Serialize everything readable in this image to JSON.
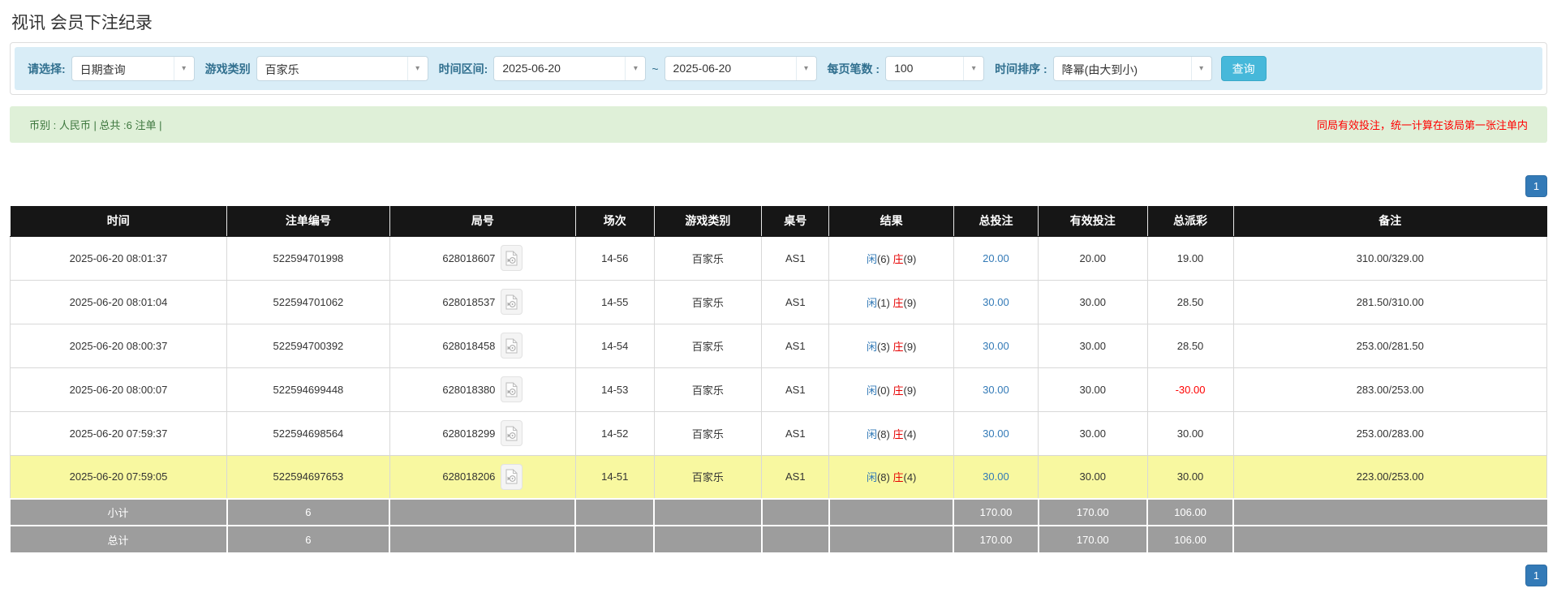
{
  "page": {
    "title": "视讯 会员下注纪录"
  },
  "filters": {
    "query_type_label": "请选择:",
    "query_type_value": "日期查询",
    "game_type_label": "游戏类别",
    "game_type_value": "百家乐",
    "time_range_label": "时间区间:",
    "date_from": "2025-06-20",
    "tilde": "~",
    "date_to": "2025-06-20",
    "page_size_label": "每页笔数 :",
    "page_size_value": "100",
    "sort_label": "时间排序 :",
    "sort_value": "降幂(由大到小)",
    "search_button": "查询"
  },
  "summary": {
    "left": "币别 : 人民币 | 总共 :6 注单 |",
    "right": "同局有效投注，统一计算在该局第一张注单内"
  },
  "pagination": {
    "page": "1"
  },
  "table": {
    "headers": [
      "时间",
      "注单编号",
      "局号",
      "场次",
      "游戏类别",
      "桌号",
      "结果",
      "总投注",
      "有效投注",
      "总派彩",
      "备注"
    ],
    "rows": [
      {
        "time": "2025-06-20 08:01:37",
        "bet_id": "522594701998",
        "round_id": "628018607",
        "session": "14-56",
        "game_type": "百家乐",
        "table_no": "AS1",
        "result": {
          "xian": "闲",
          "xian_n": "(6)",
          "zhuang": "庄",
          "zhuang_n": "(9)"
        },
        "total_bet": "20.00",
        "valid_bet": "20.00",
        "payout": "19.00",
        "payout_negative": false,
        "note": "310.00/329.00",
        "highlight": false
      },
      {
        "time": "2025-06-20 08:01:04",
        "bet_id": "522594701062",
        "round_id": "628018537",
        "session": "14-55",
        "game_type": "百家乐",
        "table_no": "AS1",
        "result": {
          "xian": "闲",
          "xian_n": "(1)",
          "zhuang": "庄",
          "zhuang_n": "(9)"
        },
        "total_bet": "30.00",
        "valid_bet": "30.00",
        "payout": "28.50",
        "payout_negative": false,
        "note": "281.50/310.00",
        "highlight": false
      },
      {
        "time": "2025-06-20 08:00:37",
        "bet_id": "522594700392",
        "round_id": "628018458",
        "session": "14-54",
        "game_type": "百家乐",
        "table_no": "AS1",
        "result": {
          "xian": "闲",
          "xian_n": "(3)",
          "zhuang": "庄",
          "zhuang_n": "(9)"
        },
        "total_bet": "30.00",
        "valid_bet": "30.00",
        "payout": "28.50",
        "payout_negative": false,
        "note": "253.00/281.50",
        "highlight": false
      },
      {
        "time": "2025-06-20 08:00:07",
        "bet_id": "522594699448",
        "round_id": "628018380",
        "session": "14-53",
        "game_type": "百家乐",
        "table_no": "AS1",
        "result": {
          "xian": "闲",
          "xian_n": "(0)",
          "zhuang": "庄",
          "zhuang_n": "(9)"
        },
        "total_bet": "30.00",
        "valid_bet": "30.00",
        "payout": "-30.00",
        "payout_negative": true,
        "note": "283.00/253.00",
        "highlight": false
      },
      {
        "time": "2025-06-20 07:59:37",
        "bet_id": "522594698564",
        "round_id": "628018299",
        "session": "14-52",
        "game_type": "百家乐",
        "table_no": "AS1",
        "result": {
          "xian": "闲",
          "xian_n": "(8)",
          "zhuang": "庄",
          "zhuang_n": "(4)"
        },
        "total_bet": "30.00",
        "valid_bet": "30.00",
        "payout": "30.00",
        "payout_negative": false,
        "note": "253.00/283.00",
        "highlight": false
      },
      {
        "time": "2025-06-20 07:59:05",
        "bet_id": "522594697653",
        "round_id": "628018206",
        "session": "14-51",
        "game_type": "百家乐",
        "table_no": "AS1",
        "result": {
          "xian": "闲",
          "xian_n": "(8)",
          "zhuang": "庄",
          "zhuang_n": "(4)"
        },
        "total_bet": "30.00",
        "valid_bet": "30.00",
        "payout": "30.00",
        "payout_negative": false,
        "note": "223.00/253.00",
        "highlight": true
      }
    ],
    "footers": [
      {
        "label": "小计",
        "count": "6",
        "total_bet": "170.00",
        "valid_bet": "170.00",
        "payout": "106.00"
      },
      {
        "label": "总计",
        "count": "6",
        "total_bet": "170.00",
        "valid_bet": "170.00",
        "payout": "106.00"
      }
    ],
    "col_widths": [
      "14.1%",
      "10.6%",
      "12.1%",
      "5.1%",
      "7.0%",
      "4.4%",
      "8.1%",
      "5.5%",
      "7.1%",
      "5.6%",
      "20.4%"
    ]
  },
  "colors": {
    "filter_bg": "#d9edf7",
    "filter_label": "#31708f",
    "search_button_bg": "#46b8da",
    "summary_bg": "#dff0d8",
    "summary_text": "#3c763d",
    "warning_red": "#ff0000",
    "header_bg": "#161616",
    "footer_bg": "#9d9d9d",
    "highlight_row": "#f8f8a0",
    "link_blue": "#337ab7",
    "banker_red": "#e60000",
    "pager_bg": "#337ab7"
  }
}
